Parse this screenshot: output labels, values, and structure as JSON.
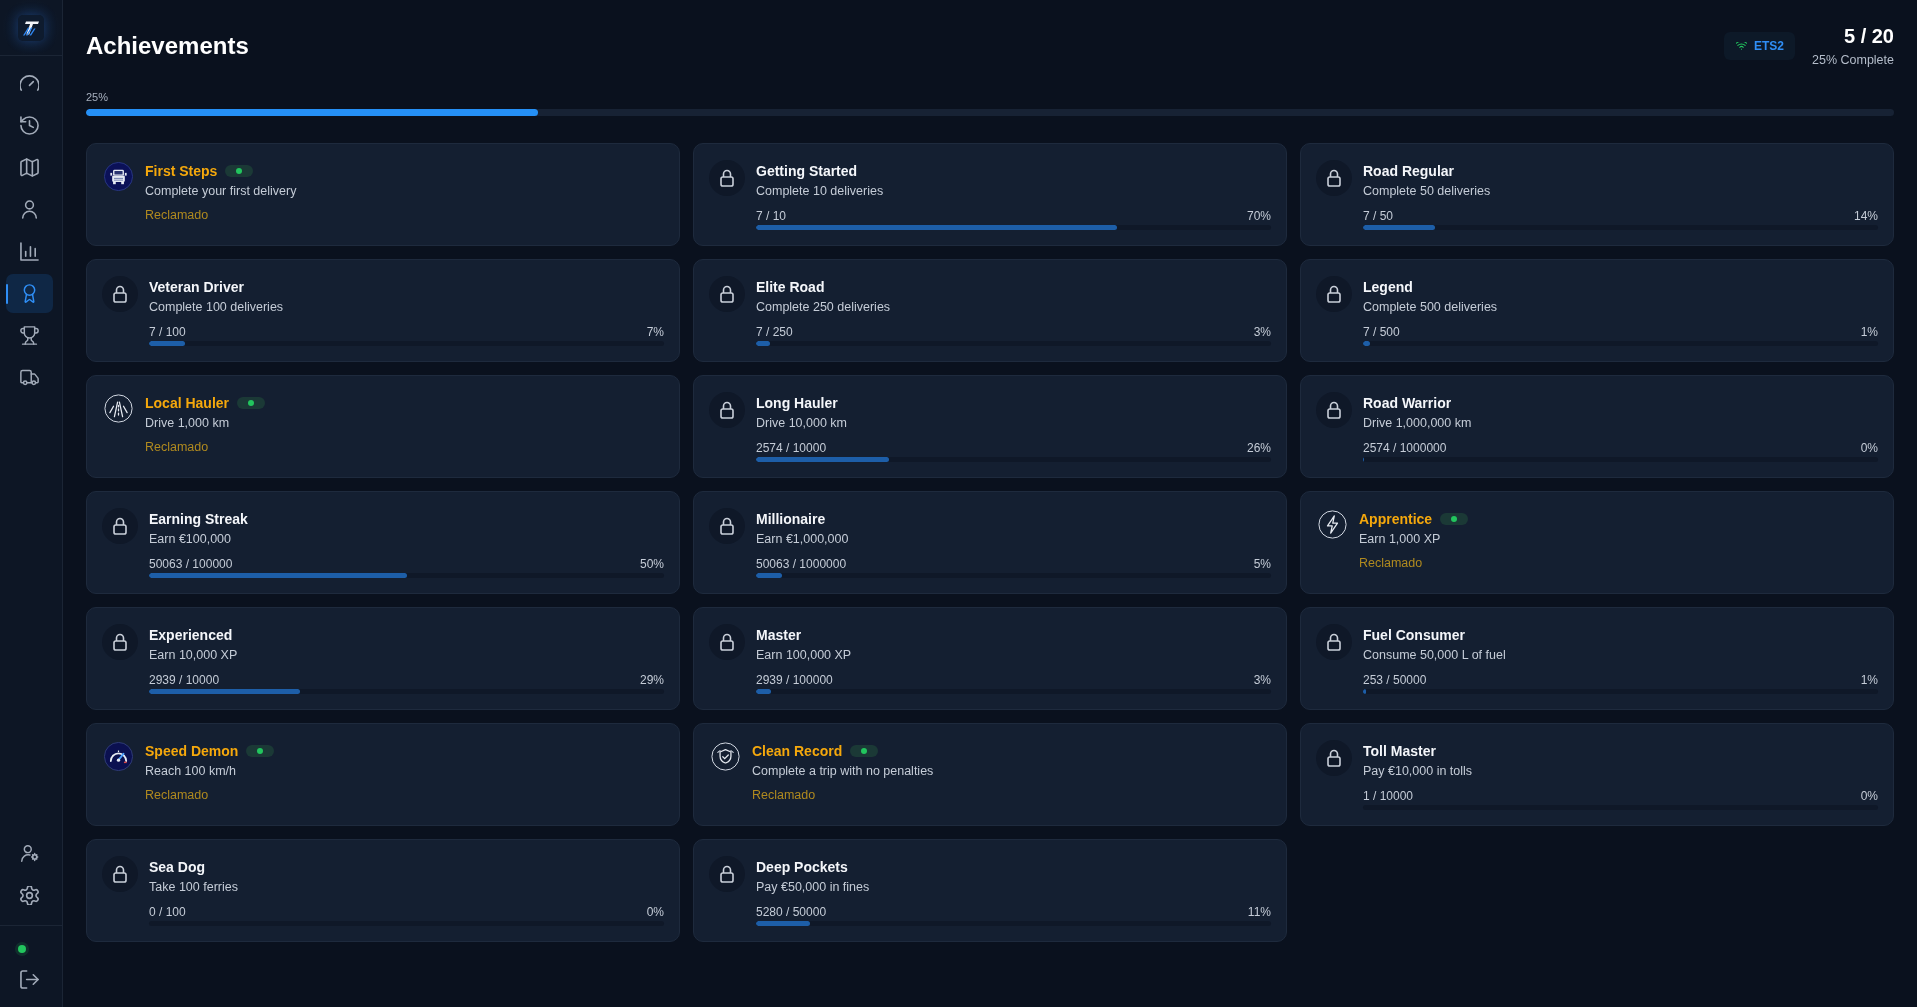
{
  "sidebar": {
    "nav_items": [
      {
        "kind": "dashboard",
        "selected": false
      },
      {
        "kind": "history",
        "selected": false
      },
      {
        "kind": "map",
        "selected": false
      },
      {
        "kind": "profile",
        "selected": false
      },
      {
        "kind": "stats",
        "selected": false
      },
      {
        "kind": "achievements",
        "selected": true
      },
      {
        "kind": "rankings",
        "selected": false
      },
      {
        "kind": "fleet",
        "selected": false
      }
    ],
    "bottom_items": [
      {
        "kind": "account",
        "selected": false
      },
      {
        "kind": "settings",
        "selected": false
      }
    ],
    "connection": {
      "online": true
    }
  },
  "header": {
    "title": "Achievements",
    "game_badge": {
      "label": "ETS2",
      "connected": true
    },
    "count": "5 / 20",
    "caption": "25% Complete"
  },
  "overall_progress": {
    "label": "25%",
    "level": 0.25
  },
  "achievements": [
    {
      "title": "First Steps",
      "description": "Complete your first delivery",
      "unlocked": true,
      "kind": "delivery",
      "status": "Reclamado"
    },
    {
      "title": "Getting Started",
      "description": "Complete 10 deliveries",
      "unlocked": false,
      "progress": "7 / 10",
      "percent": "70%",
      "level": 0.7
    },
    {
      "title": "Road Regular",
      "description": "Complete 50 deliveries",
      "unlocked": false,
      "progress": "7 / 50",
      "percent": "14%",
      "level": 0.14
    },
    {
      "title": "Veteran Driver",
      "description": "Complete 100 deliveries",
      "unlocked": false,
      "progress": "7 / 100",
      "percent": "7%",
      "level": 0.07
    },
    {
      "title": "Elite Road",
      "description": "Complete 250 deliveries",
      "unlocked": false,
      "progress": "7 / 250",
      "percent": "3%",
      "level": 0.028
    },
    {
      "title": "Legend",
      "description": "Complete 500 deliveries",
      "unlocked": false,
      "progress": "7 / 500",
      "percent": "1%",
      "level": 0.014
    },
    {
      "title": "Local Hauler",
      "description": "Drive 1,000 km",
      "unlocked": true,
      "kind": "distance",
      "status": "Reclamado"
    },
    {
      "title": "Long Hauler",
      "description": "Drive 10,000 km",
      "unlocked": false,
      "progress": "2574 / 10000",
      "percent": "26%",
      "level": 0.2574
    },
    {
      "title": "Road Warrior",
      "description": "Drive 1,000,000 km",
      "unlocked": false,
      "progress": "2574 / 1000000",
      "percent": "0%",
      "level": 0.0026
    },
    {
      "title": "Earning Streak",
      "description": "Earn €100,000",
      "unlocked": false,
      "progress": "50063 / 100000",
      "percent": "50%",
      "level": 0.5006
    },
    {
      "title": "Millionaire",
      "description": "Earn €1,000,000",
      "unlocked": false,
      "progress": "50063 / 1000000",
      "percent": "5%",
      "level": 0.05
    },
    {
      "title": "Apprentice",
      "description": "Earn 1,000 XP",
      "unlocked": true,
      "kind": "xp",
      "status": "Reclamado"
    },
    {
      "title": "Experienced",
      "description": "Earn 10,000 XP",
      "unlocked": false,
      "progress": "2939 / 10000",
      "percent": "29%",
      "level": 0.2939
    },
    {
      "title": "Master",
      "description": "Earn 100,000 XP",
      "unlocked": false,
      "progress": "2939 / 100000",
      "percent": "3%",
      "level": 0.0294
    },
    {
      "title": "Fuel Consumer",
      "description": "Consume 50,000 L of fuel",
      "unlocked": false,
      "progress": "253 / 50000",
      "percent": "1%",
      "level": 0.005
    },
    {
      "title": "Speed Demon",
      "description": "Reach 100 km/h",
      "unlocked": true,
      "kind": "speed",
      "status": "Reclamado"
    },
    {
      "title": "Clean Record",
      "description": "Complete a trip with no penalties",
      "unlocked": true,
      "kind": "safety",
      "status": "Reclamado"
    },
    {
      "title": "Toll Master",
      "description": "Pay €10,000 in tolls",
      "unlocked": false,
      "progress": "1 / 10000",
      "percent": "0%",
      "level": 0.0001
    },
    {
      "title": "Sea Dog",
      "description": "Take 100 ferries",
      "unlocked": false,
      "progress": "0 / 100",
      "percent": "0%",
      "level": 0
    },
    {
      "title": "Deep Pockets",
      "description": "Pay €50,000 in fines",
      "unlocked": false,
      "progress": "5280 / 50000",
      "percent": "11%",
      "level": 0.1056
    }
  ]
}
